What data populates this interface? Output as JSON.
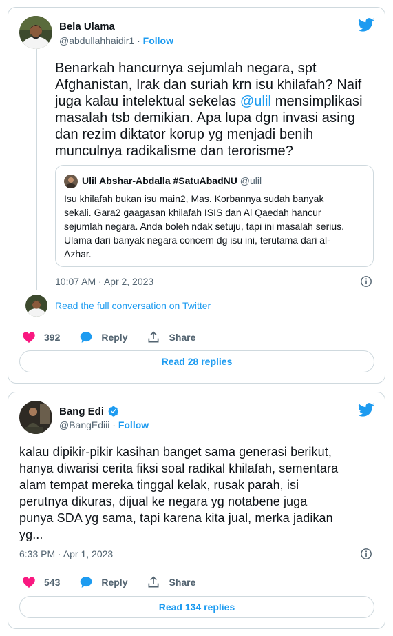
{
  "colors": {
    "accent": "#1d9bf0",
    "like": "#f91880",
    "muted": "#536471",
    "border": "#cfd9de"
  },
  "tweet1": {
    "name": "Bela Ulama",
    "handle": "@abdullahhaidir1",
    "separator": "·",
    "follow": "Follow",
    "text_before_mention": "Benarkah hancurnya sejumlah negara,  spt\nAfghanistan, Irak dan suriah krn isu khilafah? Naif\njuga kalau intelektual sekelas ",
    "mention": "@ulil",
    "text_after_mention": " mensimplikasi\nmasalah tsb demikian.  Apa lupa dgn invasi asing\ndan rezim diktator korup yg menjadi benih\nmunculnya radikalisme dan terorisme?",
    "quote": {
      "name": "Ulil Abshar-Abdalla #SatuAbadNU",
      "handle": "@ulil",
      "text": "Isu khilafah bukan isu main2, Mas. Korbannya sudah banyak\nsekali. Gara2 gaagasan khilafah ISIS dan Al Qaedah hancur\nsejumlah negara. Anda boleh ndak setuju, tapi ini masalah serius.\nUlama dari banyak negara concern dg isu ini, terutama dari al-\nAzhar."
    },
    "timestamp": "10:07 AM · Apr 2, 2023",
    "read_full": "Read the full conversation on Twitter",
    "likes": "392",
    "reply": "Reply",
    "share": "Share",
    "read_replies": "Read 28 replies"
  },
  "tweet2": {
    "name": "Bang Edi",
    "handle": "@BangEdiii",
    "separator": "·",
    "follow": "Follow",
    "text": "kalau dipikir-pikir kasihan banget sama generasi berikut,\nhanya diwarisi cerita fiksi soal radikal khilafah, sementara\nalam tempat mereka tinggal kelak, rusak parah, isi\nperutnya dikuras, dijual ke negara yg notabene juga\npunya SDA yg sama, tapi karena kita jual, merka jadikan\nyg...",
    "timestamp": "6:33 PM · Apr 1, 2023",
    "likes": "543",
    "reply": "Reply",
    "share": "Share",
    "read_replies": "Read 134 replies"
  }
}
